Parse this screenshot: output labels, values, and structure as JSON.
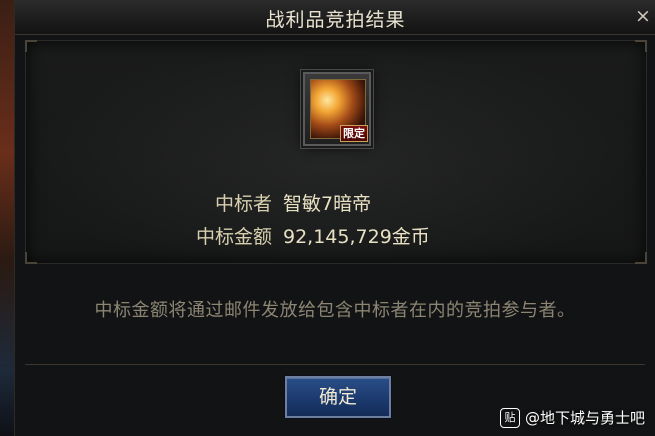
{
  "dialog": {
    "title": "战利品竞拍结果",
    "close_label": "×"
  },
  "item": {
    "badge": "限定"
  },
  "result": {
    "winner_label": "中标者",
    "winner_value": "智敏7暗帝",
    "amount_label": "中标金额",
    "amount_value": "92,145,729金币"
  },
  "notice": "中标金额将通过邮件发放给包含中标者在内的竞拍参与者。",
  "buttons": {
    "confirm_label": "确定"
  },
  "watermark": {
    "icon": "贴",
    "text": "@地下城与勇士吧"
  }
}
